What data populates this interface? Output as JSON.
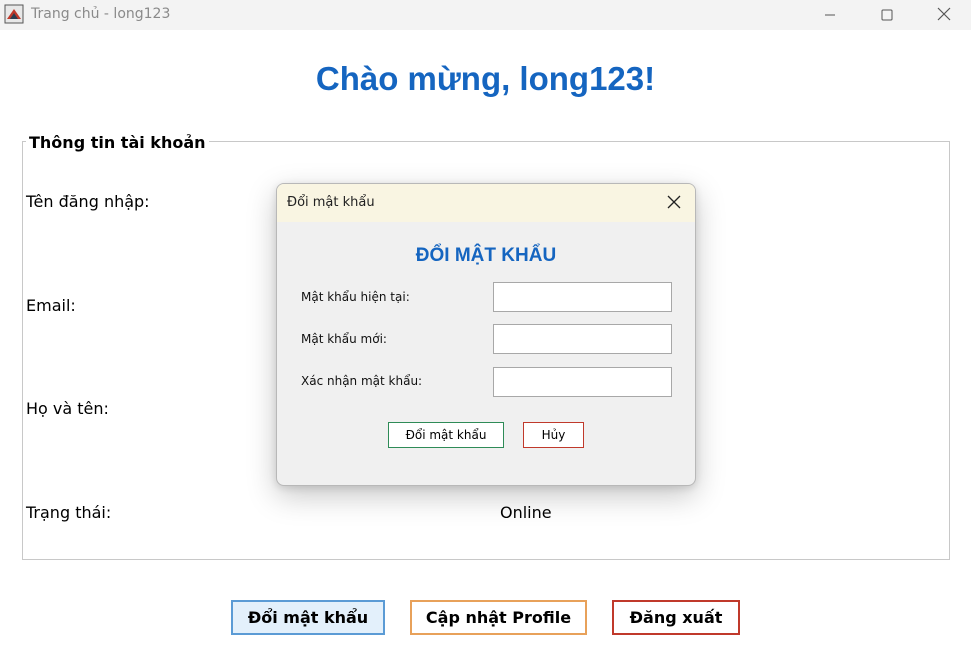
{
  "window": {
    "title": "Trang chủ - long123",
    "icon": "java-app-icon",
    "controls": [
      "minimize-icon",
      "maximize-icon",
      "close-icon"
    ]
  },
  "main": {
    "welcome": "Chào mừng, long123!",
    "account_group": {
      "legend": "Thông tin tài khoản",
      "fields": [
        {
          "label": "Tên đăng nhập:",
          "value": ""
        },
        {
          "label": "Email:",
          "value": ""
        },
        {
          "label": "Họ và tên:",
          "value": ""
        },
        {
          "label": "Trạng thái:",
          "value": "Online"
        }
      ]
    },
    "buttons": {
      "change_password": "Đổi mật khẩu",
      "update_profile": "Cập nhật Profile",
      "logout": "Đăng xuất"
    }
  },
  "dialog": {
    "title": "Đổi mật khẩu",
    "heading": "ĐỔI MẬT KHẨU",
    "fields": [
      {
        "label": "Mật khẩu hiện tại:",
        "value": ""
      },
      {
        "label": "Mật khẩu mới:",
        "value": ""
      },
      {
        "label": "Xác nhận mật khẩu:",
        "value": ""
      }
    ],
    "ok_label": "Đổi mật khẩu",
    "cancel_label": "Hủy"
  },
  "colors": {
    "accent_blue": "#1565c0",
    "ok_border": "#2e8b57",
    "cancel_border": "#c0392b",
    "update_border": "#e8a15a",
    "change_border": "#5b9bd5"
  }
}
